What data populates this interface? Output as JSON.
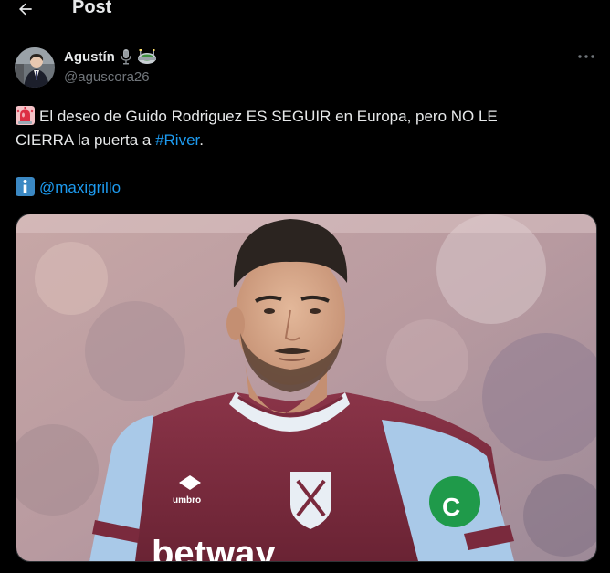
{
  "header": {
    "title": "Post",
    "back_icon": "arrow-left-icon"
  },
  "author": {
    "name": "Agustín",
    "handle": "@aguscora26",
    "name_emojis": [
      "microphone-icon",
      "stadium-icon"
    ]
  },
  "more_icon": "more-horizontal-icon",
  "tweet": {
    "line1_prefix": "El deseo de Guido Rodriguez ES SEGUIR en Europa, pero NO LE",
    "line2_prefix": "CIERRA la puerta a ",
    "hashtag": "#River",
    "line2_suffix": ".",
    "source_mention": "@maxigrillo",
    "emoji_siren": "police-light-icon",
    "emoji_info": "information-icon"
  },
  "media": {
    "shirt_brand": "umbro",
    "sponsor": "betway"
  },
  "colors": {
    "background": "#000000",
    "text": "#e7e9ea",
    "secondary": "#71767b",
    "link": "#1d9bf0",
    "border": "#2f3336",
    "shirt_claret": "#7a2a3d",
    "shirt_blue": "#a9c9e8"
  }
}
